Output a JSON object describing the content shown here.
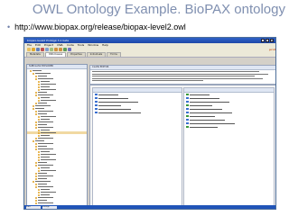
{
  "slide": {
    "title": "OWL Ontology Example. BioPAX ontology",
    "bullet_url": "http://www.biopax.org/release/biopax-level2.owl",
    "title_color": "#7f8fb0"
  },
  "app": {
    "window_title": "biopax-level2 Protégé 3.1 beta",
    "logo": "protégé",
    "menu": [
      "File",
      "Edit",
      "Project",
      "OWL",
      "Code",
      "Tools",
      "Window",
      "Help"
    ],
    "tabs": [
      "Metadata",
      "OWLClasses",
      "Properties",
      "Individuals",
      "Forms"
    ],
    "active_tab": "OWLClasses",
    "class_browser_label": "SUBCLASS EXPLORER",
    "class_editor_label": "CLASS EDITOR",
    "status_items": [
      "start",
      "Protégé"
    ],
    "colors": {
      "accent": "#2054b8",
      "selection": "#f1d9a2",
      "window_bg": "#d4d0c8"
    }
  }
}
